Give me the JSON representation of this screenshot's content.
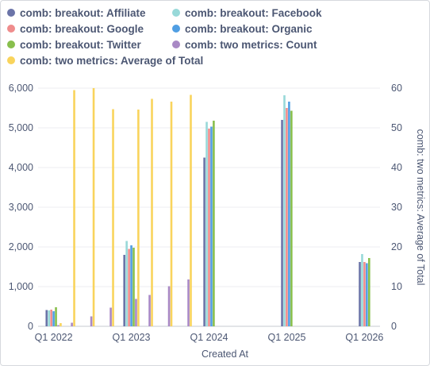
{
  "chart_data": {
    "type": "bar",
    "title": "",
    "xlabel": "Created At",
    "ylabel": "",
    "y2label": "comb: two metrics: Average of Total",
    "ylim": [
      0,
      6000
    ],
    "y2lim": [
      0,
      60
    ],
    "yticks": [
      "0",
      "1,000",
      "2,000",
      "3,000",
      "4,000",
      "5,000",
      "6,000"
    ],
    "y2ticks": [
      "0",
      "10",
      "20",
      "30",
      "40",
      "50",
      "60"
    ],
    "xticks": [
      {
        "label": "Q1 2022",
        "t": 2022.0
      },
      {
        "label": "Q1 2023",
        "t": 2023.0
      },
      {
        "label": "Q1 2024",
        "t": 2024.0
      },
      {
        "label": "Q1 2025",
        "t": 2025.0
      },
      {
        "label": "Q1 2026",
        "t": 2026.0
      }
    ],
    "xrange": [
      2021.8,
      2026.2
    ],
    "legend_position": "top",
    "grid": true,
    "series": [
      {
        "name": "comb: breakout: Affiliate",
        "color": "#6b74a8",
        "axis": "left",
        "points": [
          [
            2022.0,
            410
          ],
          [
            2023.0,
            1800
          ],
          [
            2024.0,
            4250
          ],
          [
            2025.0,
            5200
          ],
          [
            2026.0,
            1620
          ]
        ]
      },
      {
        "name": "comb: breakout: Facebook",
        "color": "#98d9d9",
        "axis": "left",
        "points": [
          [
            2022.0,
            400
          ],
          [
            2023.0,
            2150
          ],
          [
            2024.0,
            5150
          ],
          [
            2025.0,
            5820
          ],
          [
            2026.0,
            1820
          ]
        ]
      },
      {
        "name": "comb: breakout: Google",
        "color": "#ef8c8c",
        "axis": "left",
        "points": [
          [
            2022.0,
            420
          ],
          [
            2023.0,
            1950
          ],
          [
            2024.0,
            4980
          ],
          [
            2025.0,
            5500
          ],
          [
            2026.0,
            1620
          ]
        ]
      },
      {
        "name": "comb: breakout: Organic",
        "color": "#509ee3",
        "axis": "left",
        "points": [
          [
            2022.0,
            380
          ],
          [
            2023.0,
            2040
          ],
          [
            2024.0,
            5030
          ],
          [
            2025.0,
            5660
          ],
          [
            2026.0,
            1590
          ]
        ]
      },
      {
        "name": "comb: breakout: Twitter",
        "color": "#88bf4d",
        "axis": "left",
        "points": [
          [
            2022.0,
            480
          ],
          [
            2023.0,
            1980
          ],
          [
            2024.0,
            5180
          ],
          [
            2025.0,
            5430
          ],
          [
            2026.0,
            1720
          ]
        ]
      },
      {
        "name": "comb: two metrics: Count",
        "color": "#a989c5",
        "axis": "left",
        "points": [
          [
            2022.0,
            30
          ],
          [
            2022.25,
            90
          ],
          [
            2022.5,
            250
          ],
          [
            2022.75,
            470
          ],
          [
            2023.0,
            690
          ],
          [
            2023.25,
            790
          ],
          [
            2023.5,
            1010
          ],
          [
            2023.75,
            1180
          ]
        ]
      },
      {
        "name": "comb: two metrics: Average of Total",
        "color": "#f9d45c",
        "axis": "right",
        "points": [
          [
            2022.0,
            0.8
          ],
          [
            2022.25,
            59.5
          ],
          [
            2022.5,
            60
          ],
          [
            2022.75,
            54.7
          ],
          [
            2023.0,
            54.6
          ],
          [
            2023.25,
            57.3
          ],
          [
            2023.5,
            56.6
          ],
          [
            2023.75,
            58.3
          ]
        ]
      }
    ]
  }
}
